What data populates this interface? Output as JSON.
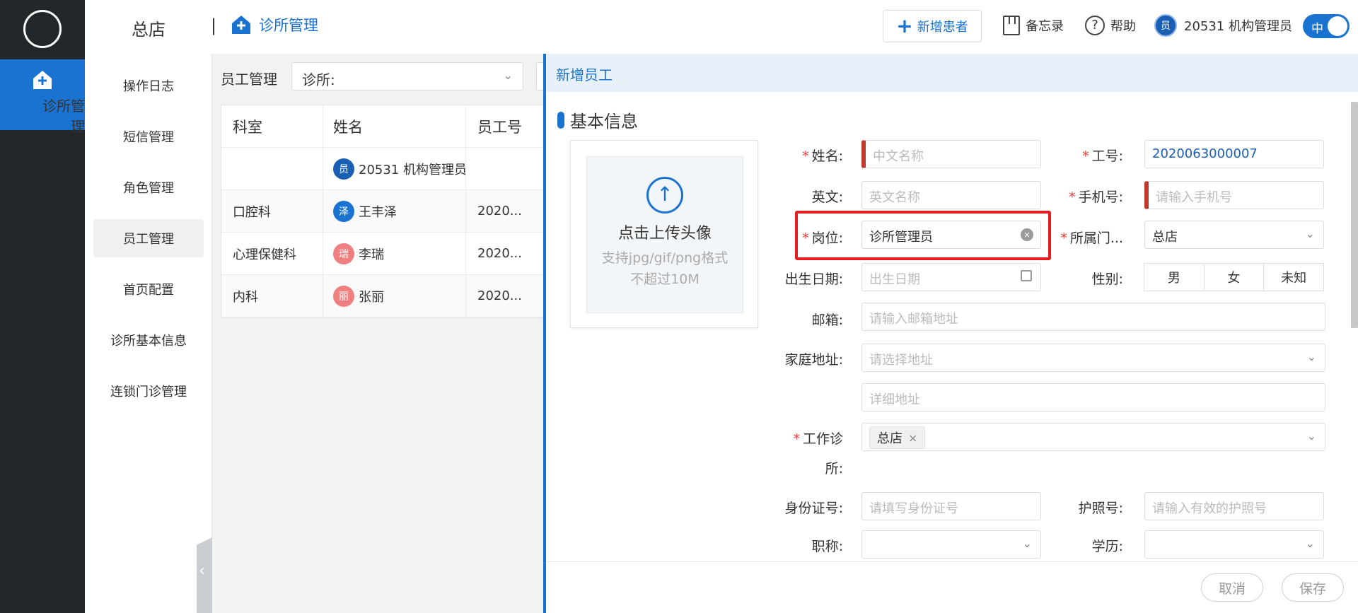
{
  "rail": {
    "active_label": "诊所管理"
  },
  "topbar": {
    "store": "总店",
    "separator": "|",
    "breadcrumb": "诊所管理",
    "new_patient": "新增患者",
    "memo": "备忘录",
    "help": "帮助",
    "user_avatar": "员",
    "user_name": "20531 机构管理员",
    "toggle": "中"
  },
  "subnav": {
    "items": [
      {
        "label": "操作日志"
      },
      {
        "label": "短信管理"
      },
      {
        "label": "角色管理"
      },
      {
        "label": "员工管理"
      },
      {
        "label": "首页配置"
      },
      {
        "label": "诊所基本信息"
      },
      {
        "label": "连锁门诊管理"
      }
    ]
  },
  "list": {
    "title": "员工管理",
    "clinic_filter": "诊所:",
    "columns": [
      "科室",
      "姓名",
      "员工号"
    ],
    "rows": [
      {
        "dept": "",
        "avatar": "员",
        "avatar_color": "#1a5fb4",
        "name": "20531 机构管理员",
        "no": ""
      },
      {
        "dept": "口腔科",
        "avatar": "泽",
        "avatar_color": "#1a73d1",
        "name": "王丰泽",
        "no": "2020..."
      },
      {
        "dept": "心理保健科",
        "avatar": "瑞",
        "avatar_color": "#f08080",
        "name": "李瑞",
        "no": "2020..."
      },
      {
        "dept": "内科",
        "avatar": "丽",
        "avatar_color": "#f08080",
        "name": "张丽",
        "no": "2020..."
      }
    ]
  },
  "drawer": {
    "title": "新增员工",
    "section": "基本信息",
    "upload": {
      "title": "点击上传头像",
      "hint1": "支持jpg/gif/png格式",
      "hint2": "不超过10M"
    },
    "fields": {
      "name_label": "姓名:",
      "name_ph": "中文名称",
      "empno_label": "工号:",
      "empno_value": "2020063000007",
      "english_label": "英文:",
      "english_ph": "英文名称",
      "phone_label": "手机号:",
      "phone_ph": "请输入手机号",
      "post_label": "岗位:",
      "post_value": "诊所管理员",
      "belong_label": "所属门...",
      "belong_value": "总店",
      "birth_label": "出生日期:",
      "birth_ph": "出生日期",
      "gender_label": "性别:",
      "gender_options": [
        "男",
        "女",
        "未知"
      ],
      "email_label": "邮箱:",
      "email_ph": "请输入邮箱地址",
      "address_label": "家庭地址:",
      "address_ph": "请选择地址",
      "address_detail_ph": "详细地址",
      "clinic_label_1": "工作诊",
      "clinic_label_2": "所:",
      "clinic_tag": "总店",
      "id_label": "身份证号:",
      "id_ph": "请填写身份证号",
      "passport_label": "护照号:",
      "passport_ph": "请输入有效的护照号",
      "title_label": "职称:",
      "edu_label": "学历:"
    },
    "cancel": "取消",
    "save": "保存"
  }
}
